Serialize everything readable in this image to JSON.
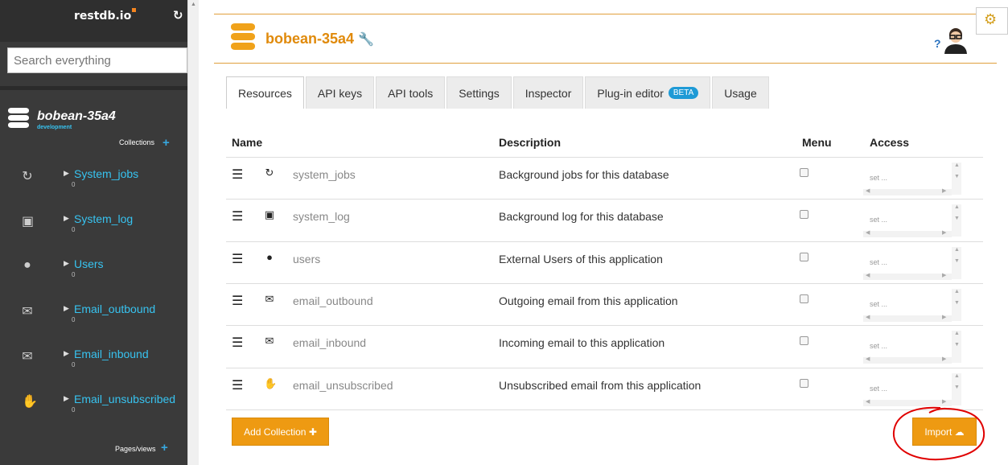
{
  "sidebar": {
    "brand": "restdb.io",
    "search_placeholder": "Search everything",
    "db_name": "bobean-35a4",
    "db_env": "development",
    "collections_label": "Collections",
    "items": [
      {
        "label": "System_jobs",
        "icon": "refresh-icon",
        "dot": "0"
      },
      {
        "label": "System_log",
        "icon": "terminal-icon",
        "dot": "0"
      },
      {
        "label": "Users",
        "icon": "user-circle-icon",
        "dot": "0"
      },
      {
        "label": "Email_outbound",
        "icon": "envelope-icon",
        "dot": "0"
      },
      {
        "label": "Email_inbound",
        "icon": "envelope-icon",
        "dot": "0"
      },
      {
        "label": "Email_unsubscribed",
        "icon": "hand-stop-icon",
        "dot": "0"
      }
    ],
    "pages_label": "Pages/views"
  },
  "header": {
    "title": "bobean-35a4",
    "help": "?"
  },
  "tabs": [
    {
      "label": "Resources",
      "active": true
    },
    {
      "label": "API keys"
    },
    {
      "label": "API tools"
    },
    {
      "label": "Settings"
    },
    {
      "label": "Inspector"
    },
    {
      "label": "Plug-in editor",
      "badge": "BETA"
    },
    {
      "label": "Usage"
    }
  ],
  "table": {
    "headers": {
      "name": "Name",
      "description": "Description",
      "menu": "Menu",
      "access": "Access"
    },
    "rows": [
      {
        "name": "system_jobs",
        "icon": "refresh-icon",
        "description": "Background jobs for this database",
        "access": "set ..."
      },
      {
        "name": "system_log",
        "icon": "terminal-icon",
        "description": "Background log for this database",
        "access": "set ..."
      },
      {
        "name": "users",
        "icon": "user-circle-icon",
        "description": "External Users of this application",
        "access": "set ..."
      },
      {
        "name": "email_outbound",
        "icon": "envelope-icon",
        "description": "Outgoing email from this application",
        "access": "set ..."
      },
      {
        "name": "email_inbound",
        "icon": "envelope-icon",
        "description": "Incoming email to this application",
        "access": "set ..."
      },
      {
        "name": "email_unsubscribed",
        "icon": "hand-stop-icon",
        "description": "Unsubscribed email from this application",
        "access": "set ..."
      }
    ]
  },
  "buttons": {
    "add_collection": "Add Collection",
    "import": "Import"
  },
  "colors": {
    "accent": "#ee9a12",
    "sidebar_bg": "#3a3a3a",
    "link": "#37c3f0",
    "annotation": "#e00000"
  }
}
